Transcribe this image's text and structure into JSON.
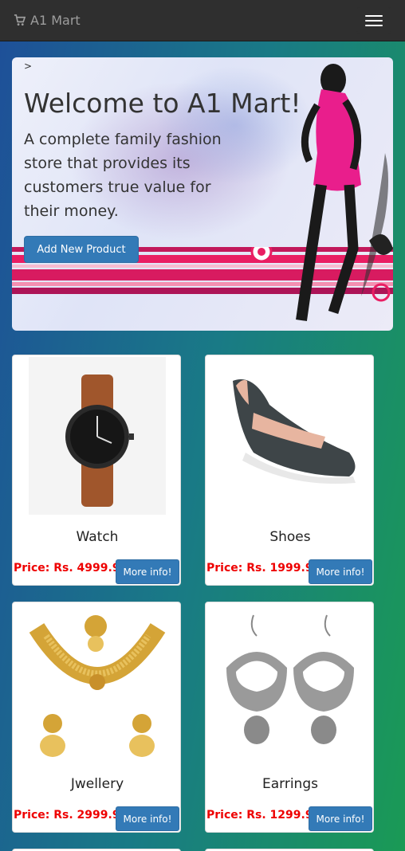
{
  "navbar": {
    "brand": "A1 Mart",
    "brand_icon": "shopping-cart-icon",
    "menu_icon": "hamburger-menu-icon"
  },
  "hero": {
    "crumb": ">",
    "title": "Welcome to A1 Mart!",
    "lead": "A complete family fashion store that provides its customers true value for their money.",
    "add_button": "Add New Product"
  },
  "products": [
    {
      "name": "Watch",
      "price": "Price: Rs. 4999.99",
      "button": "More info!"
    },
    {
      "name": "Shoes",
      "price": "Price: Rs. 1999.99",
      "button": "More info!"
    },
    {
      "name": "Jwellery",
      "price": "Price: Rs. 2999.99",
      "button": "More info!"
    },
    {
      "name": "Earrings",
      "price": "Price: Rs. 1299.99",
      "button": "More info!"
    }
  ],
  "colors": {
    "price": "#ee0000",
    "button": "#337ab7",
    "navbar": "#2f2f2f"
  }
}
